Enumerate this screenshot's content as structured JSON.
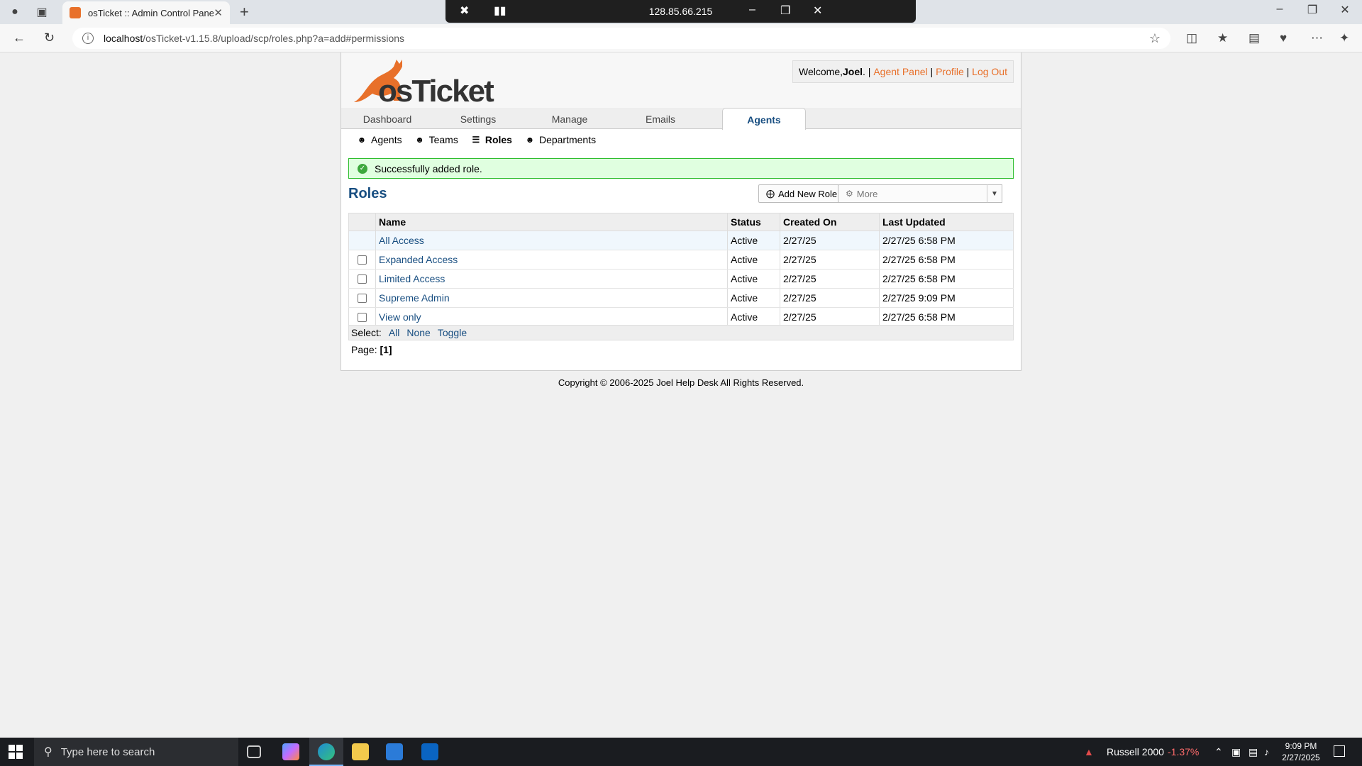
{
  "browser": {
    "tab_title": "osTicket :: Admin Control Panel",
    "url_host": "localhost",
    "url_path": "/osTicket-v1.15.8/upload/scp/roles.php?a=add#permissions",
    "rdp_ip": "128.85.66.215"
  },
  "header": {
    "logo_text": "osTicket",
    "welcome_prefix": "Welcome, ",
    "user": "Joel",
    "welcome_suffix": ". | ",
    "agent_panel": "Agent Panel",
    "sep": " | ",
    "profile": "Profile",
    "logout": "Log Out"
  },
  "mainnav": [
    "Dashboard",
    "Settings",
    "Manage",
    "Emails",
    "Agents"
  ],
  "subnav": [
    "Agents",
    "Teams",
    "Roles",
    "Departments"
  ],
  "message": "Successfully added role.",
  "page_title": "Roles",
  "buttons": {
    "add": "Add New Role",
    "more": "More"
  },
  "table": {
    "headers": [
      "Name",
      "Status",
      "Created On",
      "Last Updated"
    ],
    "rows": [
      {
        "name": "All Access",
        "status": "Active",
        "created": "2/27/25",
        "updated": "2/27/25 6:58 PM"
      },
      {
        "name": "Expanded Access",
        "status": "Active",
        "created": "2/27/25",
        "updated": "2/27/25 6:58 PM"
      },
      {
        "name": "Limited Access",
        "status": "Active",
        "created": "2/27/25",
        "updated": "2/27/25 6:58 PM"
      },
      {
        "name": "Supreme Admin",
        "status": "Active",
        "created": "2/27/25",
        "updated": "2/27/25 9:09 PM"
      },
      {
        "name": "View only",
        "status": "Active",
        "created": "2/27/25",
        "updated": "2/27/25 6:58 PM"
      }
    ]
  },
  "select": {
    "label": "Select:",
    "all": "All",
    "none": "None",
    "toggle": "Toggle"
  },
  "pager": {
    "label": "Page:",
    "current": "[1]"
  },
  "footer": "Copyright © 2006-2025 Joel Help Desk All Rights Reserved.",
  "taskbar": {
    "search_placeholder": "Type here to search",
    "ticker_name": "Russell 2000",
    "ticker_change": "-1.37%",
    "time": "9:09 PM",
    "date": "2/27/2025"
  },
  "colors": {
    "accent": "#e8702a",
    "link": "#184e81",
    "success_bg": "#e0ffe0",
    "success_border": "#2cbe2c",
    "ticker_down": "#ff6b6b"
  }
}
